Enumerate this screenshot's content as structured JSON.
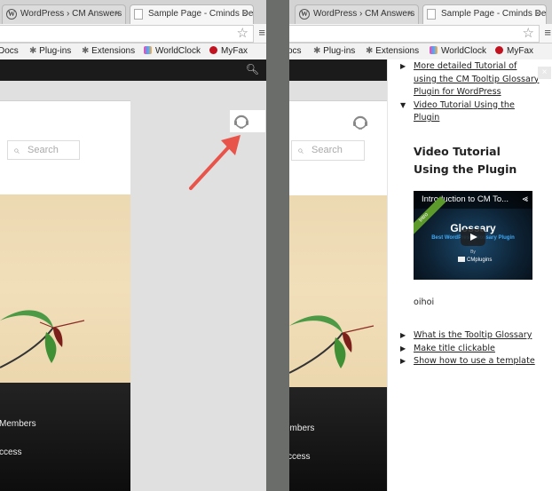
{
  "browser": {
    "tabs": [
      {
        "label": "WordPress › CM Answers",
        "icon": "wordpress-icon",
        "active": false
      },
      {
        "label": "Sample Page - Cminds De",
        "icon": "document-icon",
        "active": true
      }
    ],
    "tab_close": "×",
    "star_icon": "☆",
    "menu_icon": "≡",
    "bookmarks": [
      {
        "label": "Docs",
        "icon": "none"
      },
      {
        "label": "Plug-ins",
        "icon": "puzzle-icon"
      },
      {
        "label": "Extensions",
        "icon": "puzzle-icon"
      },
      {
        "label": "WorldClock",
        "icon": "worldclock-icon"
      },
      {
        "label": "MyFax",
        "icon": "myfax-icon"
      }
    ],
    "bookmarks_right_first": "ocs"
  },
  "page": {
    "search_placeholder": "Search",
    "search_icon": "⌕",
    "footer_items_left": [
      "Members",
      "ccess"
    ],
    "footer_items_right": [
      "embers",
      "ccess"
    ]
  },
  "annotation": {
    "arrow_color": "#e8534a"
  },
  "help_panel": {
    "close_icon": "×",
    "top_links": [
      {
        "text": "More detailed Tutorial of using the CM Tooltip Glossary Plugin for WordPress",
        "expanded": false
      },
      {
        "text": "Video Tutorial Using the Plugin",
        "expanded": true
      }
    ],
    "heading": "Video Tutorial Using the Plugin",
    "video": {
      "title": "Introduction to CM To...",
      "ribbon": "Intro",
      "headline": "Glossary",
      "subline": "Best WordPress Glossary Plugin",
      "by": "By",
      "brand": "CMplugins"
    },
    "text": "oihoi",
    "bottom_links": [
      {
        "text": "What is the Tooltip Glossary"
      },
      {
        "text": "Make title clickable"
      },
      {
        "text": "Show how to use a template"
      }
    ]
  }
}
